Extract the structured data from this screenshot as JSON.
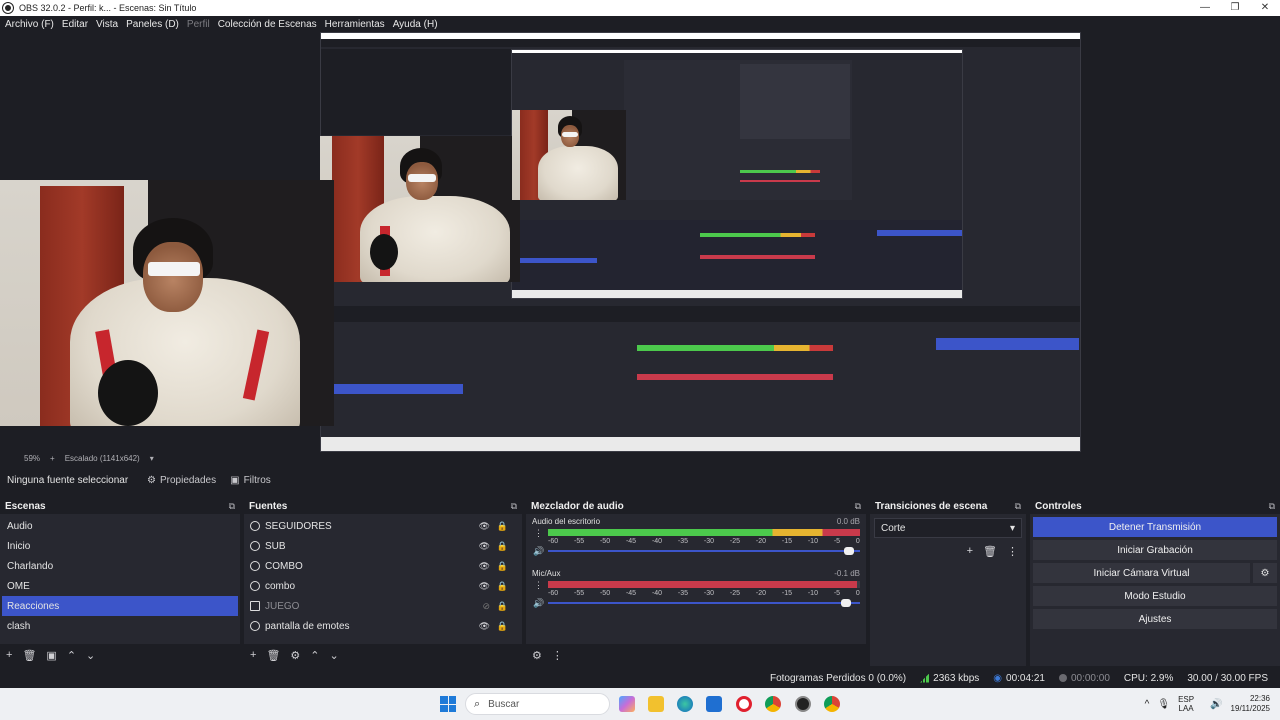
{
  "window": {
    "title": "OBS 32.0.2 - Perfil: k... - Escenas: Sin Título",
    "controls": [
      "—",
      "❐",
      "✕"
    ]
  },
  "menu": [
    {
      "label": "Archivo (F)",
      "enabled": true
    },
    {
      "label": "Editar",
      "enabled": true
    },
    {
      "label": "Vista",
      "enabled": true
    },
    {
      "label": "Paneles (D)",
      "enabled": true
    },
    {
      "label": "Perfil",
      "enabled": false
    },
    {
      "label": "Colección de Escenas",
      "enabled": true
    },
    {
      "label": "Herramientas",
      "enabled": true
    },
    {
      "label": "Ayuda (H)",
      "enabled": true
    }
  ],
  "preview_status": {
    "zoom": "59%",
    "plus": "+",
    "scaling": "Escalado (1141x642)"
  },
  "source_toolbar": {
    "no_source": "Ninguna fuente seleccionar",
    "properties": "Propiedades",
    "filters": "Filtros"
  },
  "scenes": {
    "title": "Escenas",
    "items": [
      "Audio",
      "Inicio",
      "Charlando",
      "OME",
      "Reacciones",
      "clash"
    ],
    "selected_index": 4
  },
  "sources": {
    "title": "Fuentes",
    "items": [
      {
        "name": "SEGUIDORES",
        "visible": true
      },
      {
        "name": "SUB",
        "visible": true
      },
      {
        "name": "COMBO",
        "visible": true
      },
      {
        "name": "combo",
        "visible": true
      },
      {
        "name": "JUEGO",
        "visible": false
      },
      {
        "name": "pantalla de emotes",
        "visible": true
      }
    ]
  },
  "mixer": {
    "title": "Mezclador de audio",
    "scale": [
      "-60",
      "-55",
      "-50",
      "-45",
      "-40",
      "-35",
      "-30",
      "-25",
      "-20",
      "-15",
      "-10",
      "-5",
      "0"
    ],
    "channels": [
      {
        "name": "Audio del escritorio",
        "db": "0.0 dB",
        "level": 1.0,
        "fader": 0.98,
        "meter_color": "#4cc94c"
      },
      {
        "name": "Mic/Aux",
        "db": "-0.1 dB",
        "level": 0.99,
        "fader": 0.97,
        "meter_color": "#c93a4b"
      }
    ]
  },
  "transitions": {
    "title": "Transiciones de escena",
    "selected": "Corte",
    "add_icon": "+",
    "delete_icon": "trash-icon",
    "menu_icon": "⋮"
  },
  "controls": {
    "title": "Controles",
    "stop_stream": "Detener Transmisión",
    "start_record": "Iniciar Grabación",
    "start_vcam": "Iniciar Cámara Virtual",
    "studio_mode": "Modo Estudio",
    "settings": "Ajustes"
  },
  "status": {
    "dropped": "Fotogramas Perdidos 0 (0.0%)",
    "bitrate": "2363 kbps",
    "stream_time": "00:04:21",
    "record_time": "00:00:00",
    "cpu": "CPU: 2.9%",
    "fps": "30.00 / 30.00 FPS"
  },
  "taskbar": {
    "search_placeholder": "Buscar",
    "lang_top": "ESP",
    "lang_bottom": "LAA",
    "time": "22:36",
    "date": "19/11/2025",
    "tray_chevron": "^"
  },
  "colors": {
    "accent": "#3c55c9",
    "meter_green": "#4cc94c",
    "meter_yellow": "#e6b430",
    "meter_red": "#c93a4b"
  }
}
